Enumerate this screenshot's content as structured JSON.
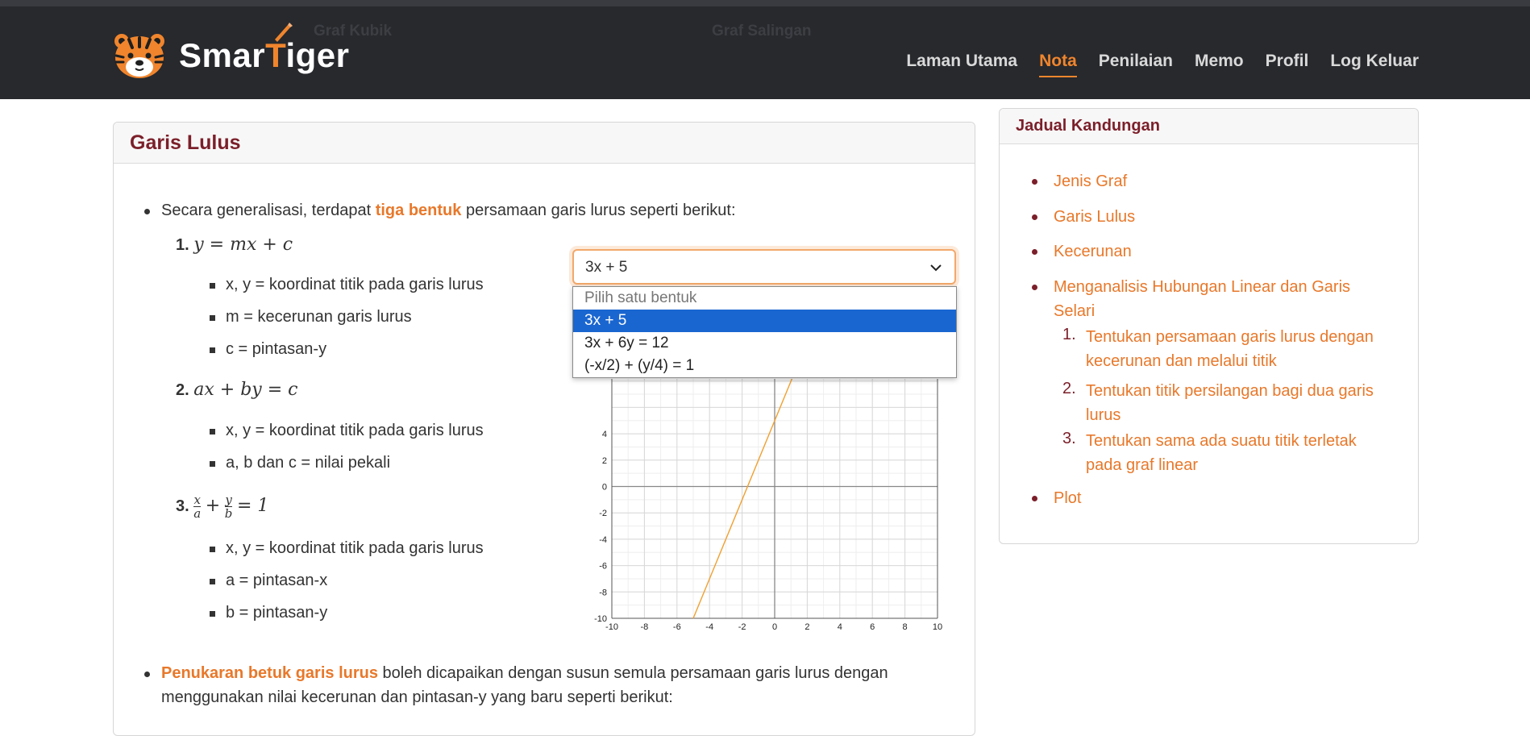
{
  "header": {
    "ghost_left": "Graf Kubik",
    "ghost_right": "Graf Salingan",
    "logo_text_a": "Smar",
    "logo_text_t": "T",
    "logo_text_b": "iger",
    "nav": [
      "Laman Utama",
      "Nota",
      "Penilaian",
      "Memo",
      "Profil",
      "Log Keluar"
    ],
    "active_nav": "Nota",
    "accent": "#f0852d"
  },
  "main": {
    "title": "Garis Lulus",
    "intro_pre": "Secara generalisasi, terdapat ",
    "intro_hl": "tiga bentuk",
    "intro_post": " persamaan garis lurus seperti berikut:",
    "forms": [
      {
        "num": "1.",
        "equation": "y = mx + c",
        "items": [
          "x, y = koordinat titik pada garis lurus",
          "m = kecerunan garis lurus",
          "c = pintasan-y"
        ]
      },
      {
        "num": "2.",
        "equation": "ax + by = c",
        "items": [
          "x, y = koordinat titik pada garis lurus",
          "a, b dan c = nilai pekali"
        ]
      },
      {
        "num": "3.",
        "eq_x": "x",
        "eq_a": "a",
        "eq_y": "y",
        "eq_b": "b",
        "eq_plus": "+",
        "eq_rest": "= 1",
        "items": [
          "x, y = koordinat titik pada garis lurus",
          "a = pintasan-x",
          "b = pintasan-y"
        ]
      }
    ],
    "conv_hl": "Penukaran betuk garis lurus",
    "conv_line1": " boleh dicapaikan dengan susun semula persamaan garis lurus dengan",
    "conv_line2": "menggunakan nilai kecerunan dan pintasan-y yang baru seperti berikut:"
  },
  "select": {
    "value": "3x + 5",
    "options": [
      "Pilih satu bentuk",
      "3x + 5",
      "3x + 6y = 12",
      "(-x/2) + (y/4) = 1"
    ],
    "selected_index": 1
  },
  "chart_data": {
    "type": "line",
    "title": "",
    "xlabel": "",
    "ylabel": "",
    "xlim": [
      -10,
      10
    ],
    "ylim": [
      -10,
      10
    ],
    "x_ticks": [
      -10,
      -8,
      -6,
      -4,
      -2,
      0,
      2,
      4,
      6,
      8,
      10
    ],
    "y_ticks": [
      -10,
      -8,
      -6,
      -4,
      -2,
      0,
      2,
      4
    ],
    "grid": true,
    "series": [
      {
        "x": [
          -5,
          1.67
        ],
        "y": [
          -10,
          10
        ],
        "color": "#f0a030"
      }
    ]
  },
  "toc": {
    "title": "Jadual Kandungan",
    "items": [
      "Jenis Graf",
      "Garis Lulus",
      "Kecerunan",
      "Menganalisis Hubungan Linear dan Garis",
      "Selari",
      "Plot"
    ],
    "sub": [
      {
        "num": "1.",
        "l1": "Tentukan persamaan garis lurus dengan",
        "l2": "kecerunan dan melalui titik"
      },
      {
        "num": "2.",
        "l1": "Tentukan titik persilangan bagi dua garis",
        "l2": "lurus"
      },
      {
        "num": "3.",
        "l1": "Tentukan sama ada suatu titik terletak",
        "l2": "pada graf linear"
      }
    ]
  }
}
